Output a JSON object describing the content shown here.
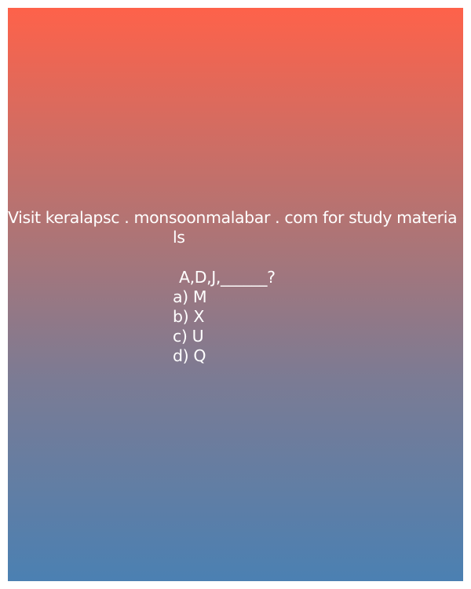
{
  "promo": {
    "line1": "Visit keralapsc . monsoonmalabar . com for study materia",
    "line2": "ls"
  },
  "question": {
    "text": "A,D,J,______?",
    "options": [
      "a) M",
      "b) X",
      "c) U",
      "d) Q"
    ]
  },
  "colors": {
    "gradient_top": "#fe624a",
    "gradient_bottom": "#4b80b2",
    "text": "#ffffff"
  }
}
